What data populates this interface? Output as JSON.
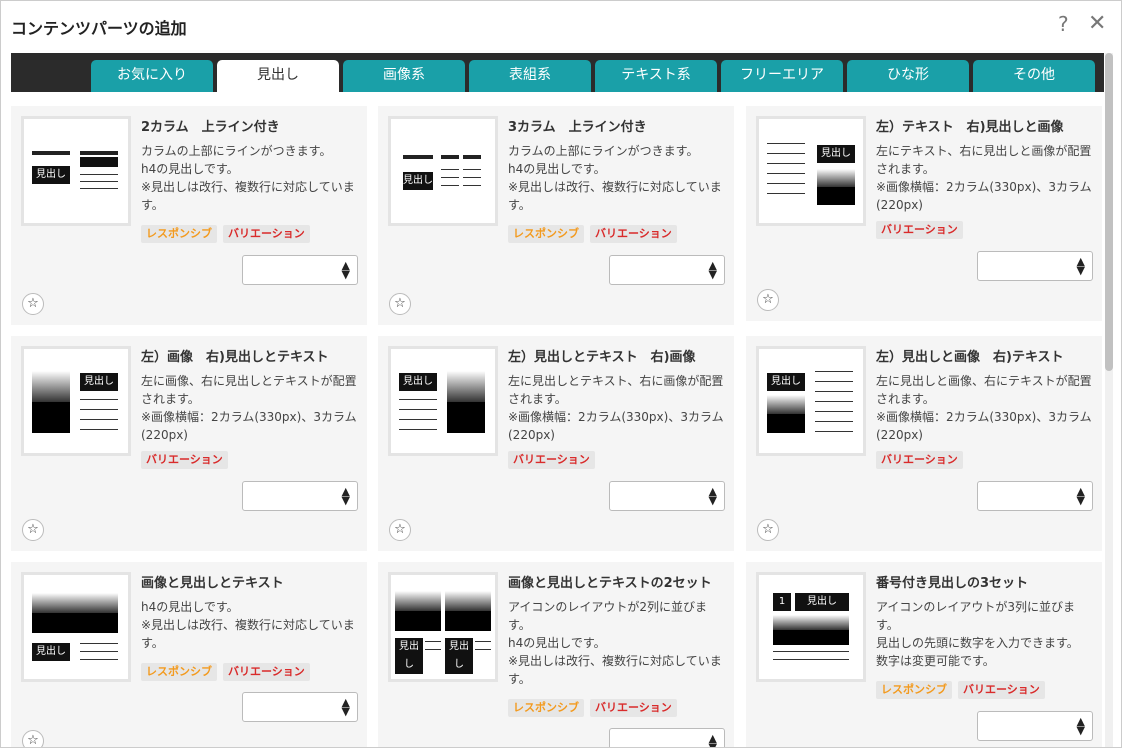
{
  "dialog": {
    "title": "コンテンツパーツの追加",
    "help": "?",
    "close": "✕"
  },
  "tabs": [
    "お気に入り",
    "見出し",
    "画像系",
    "表組系",
    "テキスト系",
    "フリーエリア",
    "ひな形",
    "その他"
  ],
  "active_tab": "見出し",
  "badge_labels": {
    "responsive": "レスポンシブ",
    "variation": "バリエーション"
  },
  "thumb_text": {
    "heading": "見出し",
    "number": "1"
  },
  "cards": [
    {
      "title": "2カラム　上ライン付き",
      "desc": "カラムの上部にラインがつきます。\nh4の見出しです。\n※見出しは改行、複数行に対応していま\nす。",
      "badges": [
        "responsive",
        "variation"
      ]
    },
    {
      "title": "3カラム　上ライン付き",
      "desc": "カラムの上部にラインがつきます。\nh4の見出しです。\n※見出しは改行、複数行に対応していま\nす。",
      "badges": [
        "responsive",
        "variation"
      ]
    },
    {
      "title": "左）テキスト　右)見出しと画像",
      "desc": "左にテキスト、右に見出しと画像が配置\nされます。\n※画像横幅：2カラム(330px)、3カラム\n(220px)",
      "badges": [
        "variation"
      ]
    },
    {
      "title": "左）画像　右)見出しとテキスト",
      "desc": "左に画像、右に見出しとテキストが配置\nされます。\n※画像横幅：2カラム(330px)、3カラム\n(220px)",
      "badges": [
        "variation"
      ]
    },
    {
      "title": "左）見出しとテキスト　右)画像",
      "desc": "左に見出しとテキスト、右に画像が配置\nされます。\n※画像横幅：2カラム(330px)、3カラム\n(220px)",
      "badges": [
        "variation"
      ]
    },
    {
      "title": "左）見出しと画像　右)テキスト",
      "desc": "左に見出しと画像、右にテキストが配置\nされます。\n※画像横幅：2カラム(330px)、3カラム\n(220px)",
      "badges": [
        "variation"
      ]
    },
    {
      "title": "画像と見出しとテキスト",
      "desc": "h4の見出しです。\n※見出しは改行、複数行に対応していま\nす。",
      "badges": [
        "responsive",
        "variation"
      ]
    },
    {
      "title": "画像と見出しとテキストの2セット",
      "desc": "アイコンのレイアウトが2列に並びま\nす。\nh4の見出しです。\n※見出しは改行、複数行に対応していま\nす。",
      "badges": [
        "responsive",
        "variation"
      ]
    },
    {
      "title": "番号付き見出しの3セット",
      "desc": "アイコンのレイアウトが3列に並びま\nす。\n見出しの先頭に数字を入力できます。\n数字は変更可能です。",
      "badges": [
        "responsive",
        "variation"
      ]
    }
  ],
  "star_icon": "☆",
  "select_caret": "▲\n▼"
}
